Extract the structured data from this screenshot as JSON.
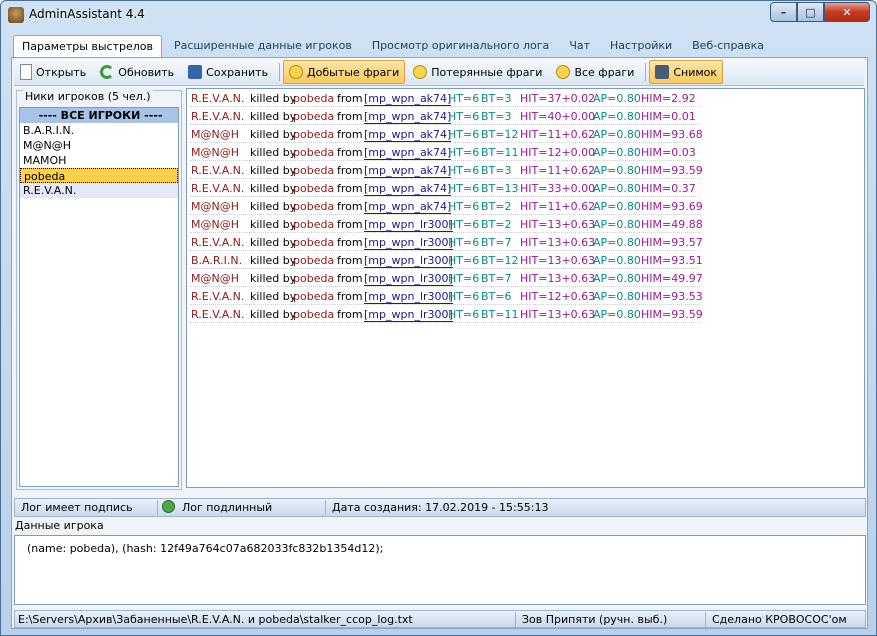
{
  "window": {
    "title": "AdminAssistant 4.4",
    "min": "–",
    "max": "□",
    "close": "✕"
  },
  "tabs": [
    "Параметры выстрелов",
    "Расширенные данные игроков",
    "Просмотр оригинального лога",
    "Чат",
    "Настройки",
    "Веб-справка"
  ],
  "toolbar": {
    "open": "Открыть",
    "refresh": "Обновить",
    "save": "Сохранить",
    "frags_got": "Добытые фраги",
    "frags_lost": "Потерянные фраги",
    "frags_all": "Все фраги",
    "snapshot": "Снимок"
  },
  "players": {
    "label": "Ники игроков (5 чел.)",
    "all": "---- ВСЕ ИГРОКИ ----",
    "items": [
      "B.A.R.I.N.",
      "M@N@H",
      "MAMOH",
      "pobeda",
      "R.E.V.A.N."
    ],
    "selected": "pobeda"
  },
  "log": {
    "killed_by": "killed by",
    "from": "from",
    "rows": [
      {
        "killer": "R.E.V.A.N.",
        "victim": "pobeda",
        "weapon": "[mp_wpn_ak74]",
        "ht": "HT=6",
        "bt": "BT=3",
        "hit": "HIT=37+0.02",
        "ap": "AP=0.80",
        "him": "HIM=2.92"
      },
      {
        "killer": "R.E.V.A.N.",
        "victim": "pobeda",
        "weapon": "[mp_wpn_ak74]",
        "ht": "HT=6",
        "bt": "BT=3",
        "hit": "HIT=40+0.00",
        "ap": "AP=0.80",
        "him": "HIM=0.01"
      },
      {
        "killer": "M@N@H",
        "victim": "pobeda",
        "weapon": "[mp_wpn_ak74]",
        "ht": "HT=6",
        "bt": "BT=12",
        "hit": "HIT=11+0.62",
        "ap": "AP=0.80",
        "him": "HIM=93.68"
      },
      {
        "killer": "M@N@H",
        "victim": "pobeda",
        "weapon": "[mp_wpn_ak74]",
        "ht": "HT=6",
        "bt": "BT=11",
        "hit": "HIT=12+0.00",
        "ap": "AP=0.80",
        "him": "HIM=0.03"
      },
      {
        "killer": "R.E.V.A.N.",
        "victim": "pobeda",
        "weapon": "[mp_wpn_ak74]",
        "ht": "HT=6",
        "bt": "BT=3",
        "hit": "HIT=11+0.62",
        "ap": "AP=0.80",
        "him": "HIM=93.59"
      },
      {
        "killer": "R.E.V.A.N.",
        "victim": "pobeda",
        "weapon": "[mp_wpn_ak74]",
        "ht": "HT=6",
        "bt": "BT=13",
        "hit": "HIT=33+0.00",
        "ap": "AP=0.80",
        "him": "HIM=0.37"
      },
      {
        "killer": "M@N@H",
        "victim": "pobeda",
        "weapon": "[mp_wpn_ak74]",
        "ht": "HT=6",
        "bt": "BT=2",
        "hit": "HIT=11+0.62",
        "ap": "AP=0.80",
        "him": "HIM=93.69"
      },
      {
        "killer": "M@N@H",
        "victim": "pobeda",
        "weapon": "[mp_wpn_lr300]",
        "ht": "HT=6",
        "bt": "BT=2",
        "hit": "HIT=13+0.63",
        "ap": "AP=0.80",
        "him": "HIM=49.88"
      },
      {
        "killer": "R.E.V.A.N.",
        "victim": "pobeda",
        "weapon": "[mp_wpn_lr300]",
        "ht": "HT=6",
        "bt": "BT=7",
        "hit": "HIT=13+0.63",
        "ap": "AP=0.80",
        "him": "HIM=93.57"
      },
      {
        "killer": "B.A.R.I.N.",
        "victim": "pobeda",
        "weapon": "[mp_wpn_lr300]",
        "ht": "HT=6",
        "bt": "BT=12",
        "hit": "HIT=13+0.63",
        "ap": "AP=0.80",
        "him": "HIM=93.51"
      },
      {
        "killer": "M@N@H",
        "victim": "pobeda",
        "weapon": "[mp_wpn_lr300]",
        "ht": "HT=6",
        "bt": "BT=7",
        "hit": "HIT=13+0.63",
        "ap": "AP=0.80",
        "him": "HIM=49.97"
      },
      {
        "killer": "R.E.V.A.N.",
        "victim": "pobeda",
        "weapon": "[mp_wpn_lr300]",
        "ht": "HT=6",
        "bt": "BT=6",
        "hit": "HIT=12+0.63",
        "ap": "AP=0.80",
        "him": "HIM=93.53"
      },
      {
        "killer": "R.E.V.A.N.",
        "victim": "pobeda",
        "weapon": "[mp_wpn_lr300]",
        "ht": "HT=6",
        "bt": "BT=11",
        "hit": "HIT=13+0.63",
        "ap": "AP=0.80",
        "him": "HIM=93.59"
      }
    ]
  },
  "status": {
    "signed": "Лог имеет подпись",
    "genuine": "Лог подлинный",
    "created": "Дата создания: 17.02.2019 - 15:55:13"
  },
  "player_data": {
    "label": "Данные игрока",
    "text": "(name: pobeda), (hash: 12f49a764c07a682033fc832b1354d12);"
  },
  "footer": {
    "path": "E:\\Servers\\Архив\\Забаненные\\R.E.V.A.N. и pobeda\\stalker_ccop_log.txt",
    "map": "Зов Припяти (ручн. выб.)",
    "credit": "Сделано КРОВОСОС'ом"
  },
  "icons": {
    "app": "app-icon",
    "open": "document-icon",
    "refresh": "refresh-icon",
    "save": "floppy-icon",
    "frag": "smiley-icon",
    "snapshot": "camera-icon",
    "ok": "check-circle-icon"
  }
}
